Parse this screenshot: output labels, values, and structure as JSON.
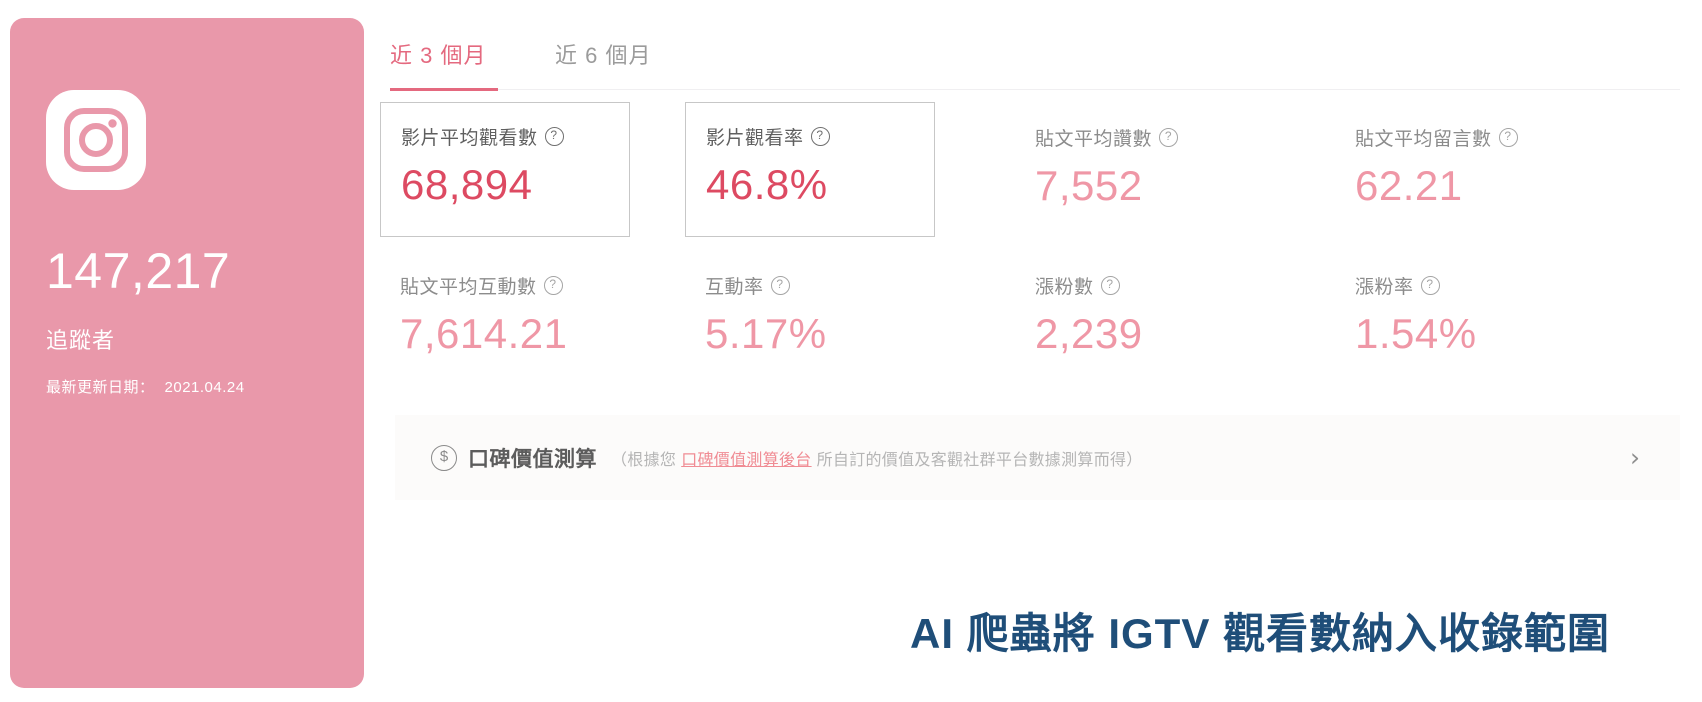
{
  "profile": {
    "platform_icon": "instagram-icon",
    "follower_count": "147,217",
    "follower_label": "追蹤者",
    "update_label": "最新更新日期：",
    "update_date": "2021.04.24",
    "panel_color": "#E998AA"
  },
  "tabs": [
    {
      "label": "近 3 個月",
      "active": true
    },
    {
      "label": "近 6 個月",
      "active": false
    }
  ],
  "metrics": [
    {
      "label": "影片平均觀看數",
      "value": "68,894",
      "boxed": true,
      "help": "help-icon"
    },
    {
      "label": "影片觀看率",
      "value": "46.8%",
      "boxed": true,
      "help": "help-icon"
    },
    {
      "label": "貼文平均讚數",
      "value": "7,552",
      "boxed": false,
      "help": "help-icon"
    },
    {
      "label": "貼文平均留言數",
      "value": "62.21",
      "boxed": false,
      "help": "help-icon"
    },
    {
      "label": "貼文平均互動數",
      "value": "7,614.21",
      "boxed": false,
      "help": "help-icon"
    },
    {
      "label": "互動率",
      "value": "5.17%",
      "boxed": false,
      "help": "help-icon"
    },
    {
      "label": "漲粉數",
      "value": "2,239",
      "boxed": false,
      "help": "help-icon"
    },
    {
      "label": "漲粉率",
      "value": "1.54%",
      "boxed": false,
      "help": "help-icon"
    }
  ],
  "value_banner": {
    "icon": "coin-dollar-icon",
    "title": "口碑價值測算",
    "sub_prefix": "（根據您",
    "link": "口碑價值測算後台",
    "sub_suffix": "所自訂的價值及客觀社群平台數據測算而得）",
    "chevron": "›"
  },
  "caption": {
    "text": "AI 爬蟲將 IGTV 觀看數納入收錄範圍",
    "color": "#1F4E79"
  },
  "colors": {
    "accent_pink": "#E998AA",
    "value_strong": "#DD4A62",
    "value_light": "#EF97A6",
    "tab_active": "#E4697F",
    "banner_bg": "#FCFBFA"
  }
}
